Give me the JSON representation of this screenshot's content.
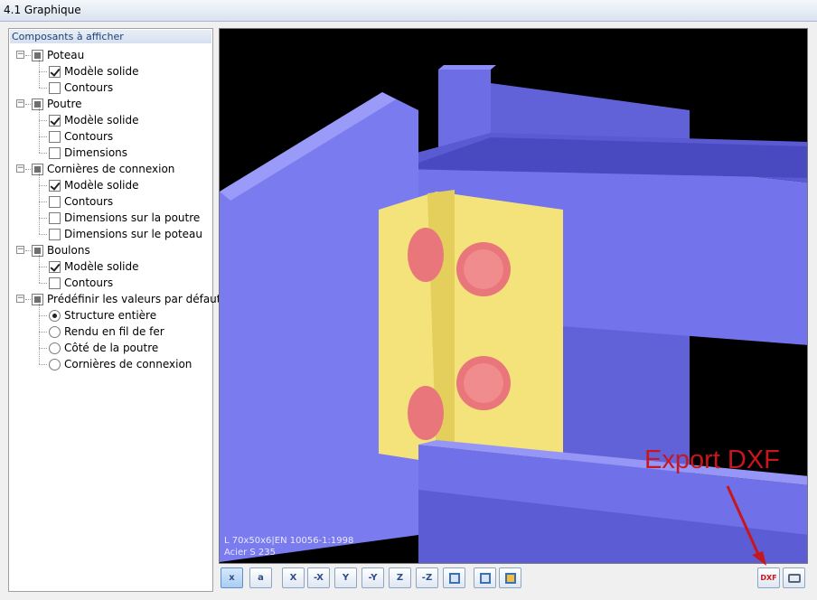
{
  "window": {
    "title": "4.1 Graphique"
  },
  "panel": {
    "title": "Composants à afficher",
    "groups": [
      {
        "label": "Poteau",
        "items": [
          {
            "label": "Modèle solide",
            "checked": true
          },
          {
            "label": "Contours",
            "checked": false
          }
        ]
      },
      {
        "label": "Poutre",
        "items": [
          {
            "label": "Modèle solide",
            "checked": true
          },
          {
            "label": "Contours",
            "checked": false
          },
          {
            "label": "Dimensions",
            "checked": false
          }
        ]
      },
      {
        "label": "Cornières de connexion",
        "items": [
          {
            "label": "Modèle solide",
            "checked": true
          },
          {
            "label": "Contours",
            "checked": false
          },
          {
            "label": "Dimensions sur la poutre",
            "checked": false
          },
          {
            "label": "Dimensions sur le poteau",
            "checked": false
          }
        ]
      },
      {
        "label": "Boulons",
        "items": [
          {
            "label": "Modèle solide",
            "checked": true
          },
          {
            "label": "Contours",
            "checked": false
          }
        ]
      },
      {
        "label": "Prédéfinir les valeurs par défaut",
        "radios": [
          {
            "label": "Structure entière",
            "selected": true
          },
          {
            "label": "Rendu en fil de fer",
            "selected": false
          },
          {
            "label": "Côté de la poutre",
            "selected": false
          },
          {
            "label": "Cornières de connexion",
            "selected": false
          }
        ]
      }
    ]
  },
  "viewport": {
    "info_line1": "L 70x50x6|EN 10056-1:1998",
    "info_line2": "Acier S 235",
    "colors": {
      "background": "#000000",
      "steel": "#7b7bf0",
      "angle": "#f4e37a",
      "bolt": "#e8767a"
    }
  },
  "toolbar": {
    "buttons": [
      {
        "name": "dimension-x-icon",
        "glyph": "x"
      },
      {
        "name": "text-icon",
        "glyph": "a"
      },
      {
        "name": "view-x-icon",
        "glyph": "X"
      },
      {
        "name": "view-minus-x-icon",
        "glyph": "-X"
      },
      {
        "name": "view-y-icon",
        "glyph": "Y"
      },
      {
        "name": "view-minus-y-icon",
        "glyph": "-Y"
      },
      {
        "name": "view-z-icon",
        "glyph": "Z"
      },
      {
        "name": "view-minus-z-icon",
        "glyph": "-Z"
      },
      {
        "name": "iso-view-icon",
        "glyph": ""
      },
      {
        "name": "settings-icon",
        "glyph": ""
      },
      {
        "name": "copy-icon",
        "glyph": ""
      }
    ],
    "dxf_label": "DXF"
  },
  "annotation": {
    "text": "Export DXF",
    "color": "#c8161d"
  }
}
